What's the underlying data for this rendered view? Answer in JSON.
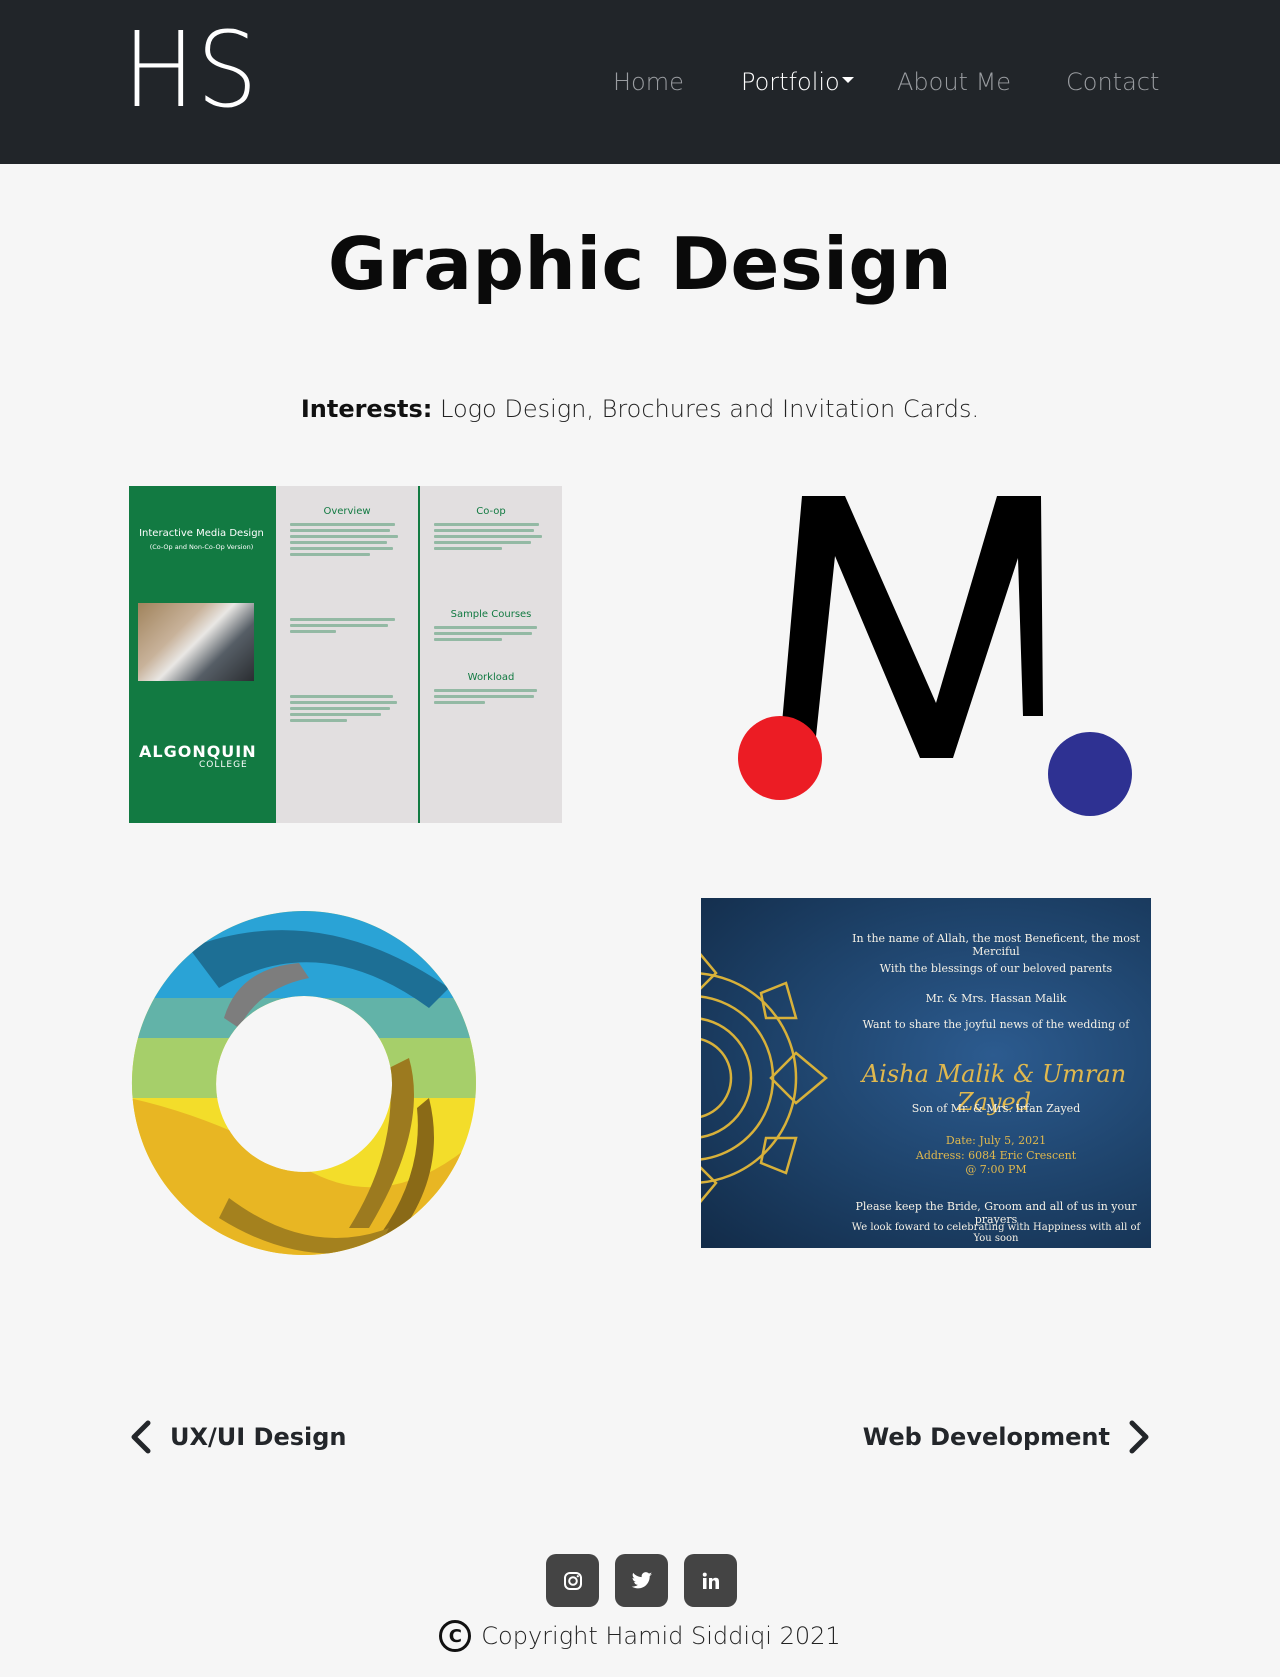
{
  "brand": {
    "logo_text": "HS"
  },
  "nav": {
    "home": "Home",
    "portfolio": "Portfolio",
    "about": "About Me",
    "contact": "Contact"
  },
  "page": {
    "title": "Graphic Design",
    "interests_label": "Interests:",
    "interests_text": " Logo Design, Brochures and Invitation Cards."
  },
  "gallery": {
    "brochure": {
      "panel_title": "Interactive Media Design",
      "panel_subtitle": "(Co-Op and Non-Co-Op Version)",
      "college_line1": "ALGONQUIN",
      "college_line2": "COLLEGE",
      "headings": [
        "Overview",
        "Co-op",
        "Sample Courses",
        "Workload"
      ]
    },
    "invitation": {
      "line1": "In the name of Allah, the most Beneficent, the most Merciful",
      "line2": "With the blessings of our beloved parents",
      "line3": "Mr. & Mrs. Hassan Malik",
      "line4": "Want to share the joyful news of the wedding of",
      "names": "Aisha Malik & Umran Zayed",
      "line5": "Son of Mr. & Mrs. Irfan Zayed",
      "date": "Date: July 5, 2021",
      "address": "Address: 6084 Eric Crescent",
      "time": "@ 7:00 PM",
      "line6": "Please keep the Bride, Groom and all of us in your prayers",
      "line7": "We look foward to celebrating with Happiness with all of You soon"
    }
  },
  "pagination": {
    "prev": "UX/UI Design",
    "next": "Web Development"
  },
  "footer": {
    "social": [
      "instagram-icon",
      "twitter-icon",
      "linkedin-icon"
    ],
    "copyright_symbol": "C",
    "copyright": "Copyright Hamid Siddiqi 2021"
  },
  "colors": {
    "navbar_bg": "#212529",
    "page_bg": "#f6f6f6",
    "brochure_green": "#127a42",
    "m_red": "#ec1c24",
    "m_blue": "#2e3192",
    "social_bg": "#444444"
  }
}
